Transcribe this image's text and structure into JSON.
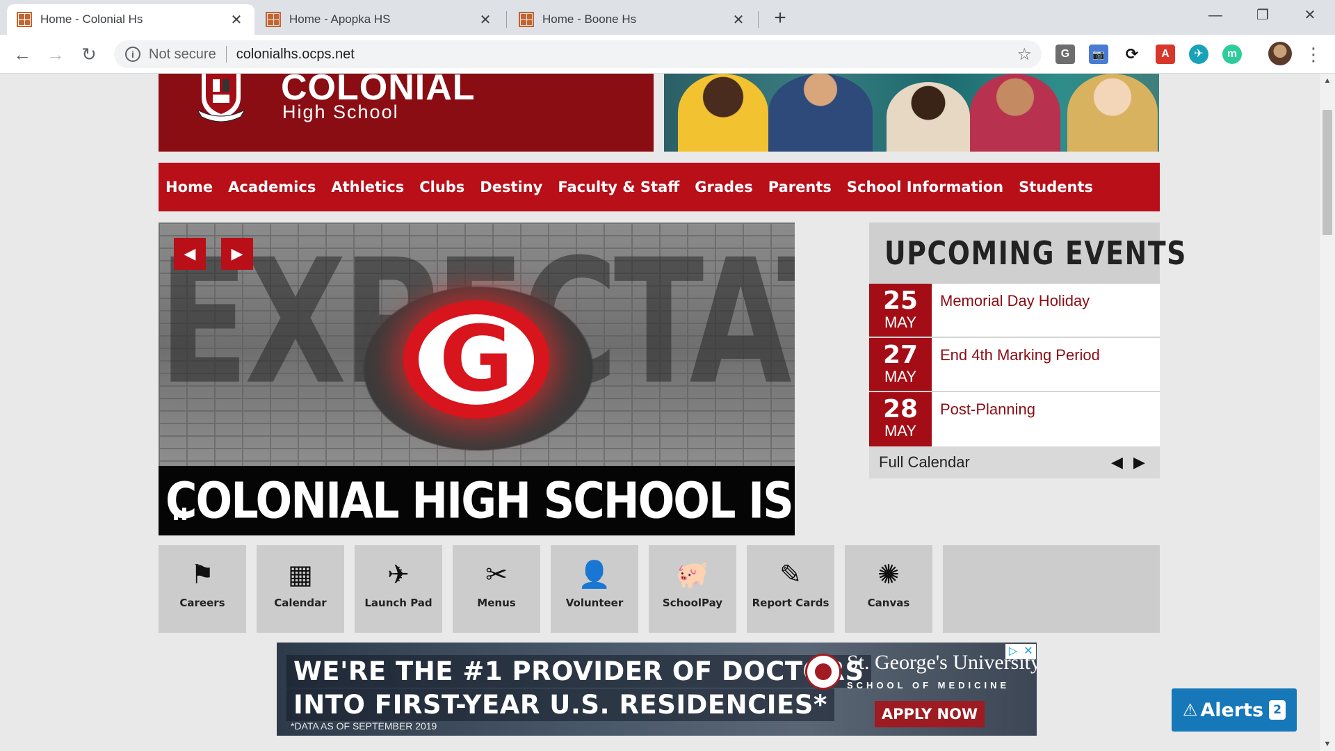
{
  "browser": {
    "tabs": [
      {
        "title": "Home - Colonial Hs",
        "close": "✕"
      },
      {
        "title": "Home - Apopka HS",
        "close": "✕"
      },
      {
        "title": "Home - Boone Hs",
        "close": "✕"
      }
    ],
    "new_tab": "+",
    "window_controls": {
      "minimize": "—",
      "restore": "❐",
      "close": "✕"
    },
    "nav": {
      "back": "←",
      "forward": "→",
      "reload": "↻"
    },
    "address": {
      "security_label": "Not secure",
      "url": "colonialhs.ocps.net",
      "info": "i",
      "bookmark": "☆"
    },
    "extensions": [
      "G",
      "📷",
      "⟳",
      "A",
      "✈",
      "m"
    ],
    "menu": "⋮"
  },
  "header": {
    "school_name": "COLONIAL",
    "school_sub": "High School"
  },
  "nav": {
    "items": [
      "Home",
      "Academics",
      "Athletics",
      "Clubs",
      "Destiny",
      "Faculty & Staff",
      "Grades",
      "Parents",
      "School Information",
      "Students"
    ]
  },
  "slider": {
    "caption": "COLONIAL HIGH SCHOOL IS A B SCHOOL!",
    "background_text": "EXPECTATIONS",
    "logo_letter": "G",
    "prev": "◀",
    "next": "▶"
  },
  "events": {
    "title": "UPCOMING EVENTS",
    "items": [
      {
        "day": "25",
        "month": "MAY",
        "title": "Memorial Day Holiday"
      },
      {
        "day": "27",
        "month": "MAY",
        "title": "End 4th Marking Period"
      },
      {
        "day": "28",
        "month": "MAY",
        "title": "Post-Planning"
      }
    ],
    "footer_label": "Full Calendar",
    "prev": "◀",
    "next": "▶"
  },
  "quicklinks": {
    "items": [
      {
        "label": "Careers",
        "icon": "⚑"
      },
      {
        "label": "Calendar",
        "icon": "▦"
      },
      {
        "label": "Launch Pad",
        "icon": "✈"
      },
      {
        "label": "Menus",
        "icon": "✂"
      },
      {
        "label": "Volunteer",
        "icon": "👤"
      },
      {
        "label": "SchoolPay",
        "icon": "🐖"
      },
      {
        "label": "Report Cards",
        "icon": "✎"
      },
      {
        "label": "Canvas",
        "icon": "✺"
      }
    ]
  },
  "ad": {
    "line1": "WE'RE THE #1 PROVIDER OF DOCTORS",
    "line2": "INTO FIRST-YEAR U.S. RESIDENCIES*",
    "footnote": "*DATA AS OF SEPTEMBER 2019",
    "brand": "St. George's University",
    "brand_sub": "SCHOOL OF MEDICINE",
    "cta": "APPLY NOW",
    "choices_icon": "▷",
    "close_icon": "✕"
  },
  "alerts": {
    "label": "Alerts",
    "count": "2",
    "icon": "⚠"
  },
  "colors": {
    "brand_red": "#b80f19",
    "dark_red": "#8a0d14",
    "alerts_blue": "#1678b8"
  }
}
